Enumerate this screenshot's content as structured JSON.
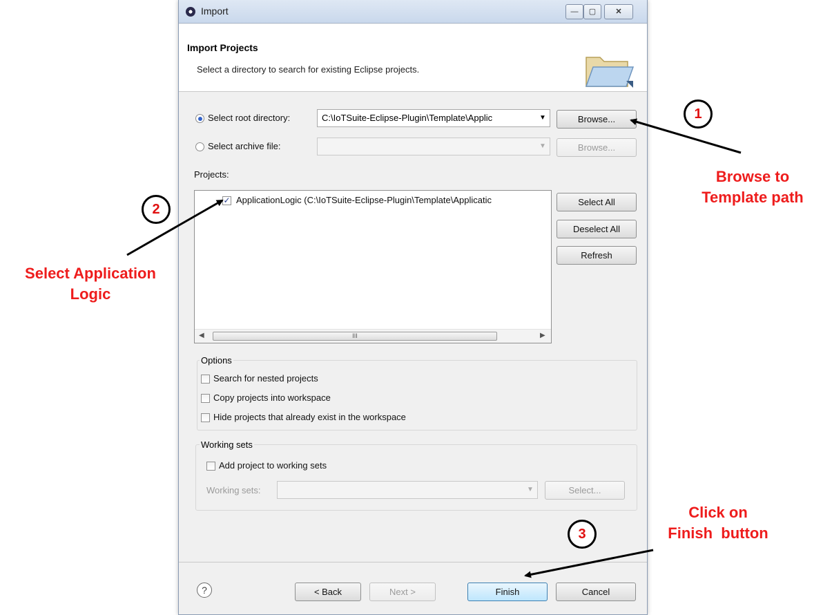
{
  "window": {
    "title": "Import",
    "controls": {
      "minimize": "—",
      "maximize": "▢",
      "close": "✕"
    }
  },
  "header": {
    "title": "Import Projects",
    "description": "Select a directory to search for existing Eclipse projects."
  },
  "source": {
    "root_label": "Select root directory:",
    "root_value": "C:\\IoTSuite-Eclipse-Plugin\\Template\\Applic",
    "archive_label": "Select archive file:",
    "archive_value": "",
    "browse_label": "Browse...",
    "browse_archive_label": "Browse..."
  },
  "projects": {
    "label": "Projects:",
    "items": [
      {
        "label": "ApplicationLogic (C:\\IoTSuite-Eclipse-Plugin\\Template\\Applicatic",
        "checked": true
      }
    ],
    "scroll_marker": "III",
    "select_all": "Select All",
    "deselect_all": "Deselect All",
    "refresh": "Refresh"
  },
  "options": {
    "title": "Options",
    "items": [
      "Search for nested projects",
      "Copy projects into workspace",
      "Hide projects that already exist in the workspace"
    ]
  },
  "working_sets": {
    "title": "Working sets",
    "add_label": "Add project to working sets",
    "sets_label": "Working sets:",
    "sets_value": "",
    "select_label": "Select..."
  },
  "footer": {
    "help": "?",
    "back": "< Back",
    "next": "Next >",
    "finish": "Finish",
    "cancel": "Cancel"
  },
  "annotations": {
    "step1": {
      "number": "1",
      "line1": "Browse to",
      "line2": "Template path"
    },
    "step2": {
      "number": "2",
      "line1": "Select Application",
      "line2": "Logic"
    },
    "step3": {
      "number": "3",
      "line1": "Click on",
      "line2": "Finish  button"
    },
    "text_color": "#ee1c1c"
  }
}
